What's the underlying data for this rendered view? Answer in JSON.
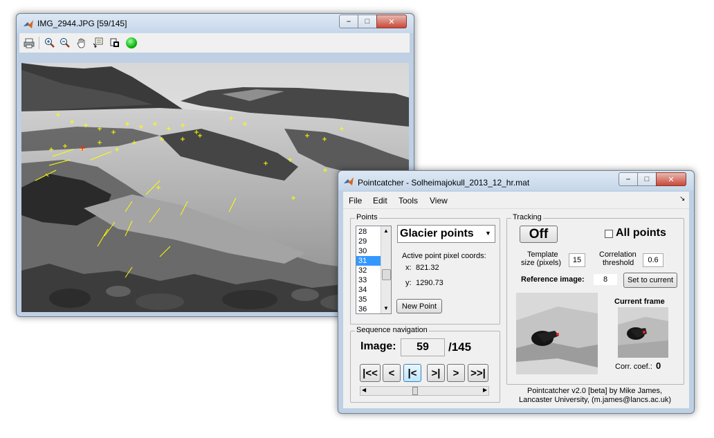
{
  "image_window": {
    "title": "IMG_2944.JPG  [59/145]",
    "toolbar": [
      {
        "name": "print-icon"
      },
      {
        "name": "zoom-in-icon"
      },
      {
        "name": "zoom-out-icon"
      },
      {
        "name": "pan-hand-icon"
      },
      {
        "name": "data-cursor-icon"
      },
      {
        "name": "insert-colorbar-icon"
      },
      {
        "name": "green-status-icon"
      }
    ]
  },
  "pointcatcher": {
    "title": "Pointcatcher - Solheimajokull_2013_12_hr.mat",
    "menu": [
      "File",
      "Edit",
      "Tools",
      "View"
    ],
    "points": {
      "label": "Points",
      "items": [
        "28",
        "29",
        "30",
        "31",
        "32",
        "33",
        "34",
        "35",
        "36"
      ],
      "selected": "31",
      "dropdown_value": "Glacier points",
      "coords_label": "Active point pixel coords:",
      "x_label": "x:",
      "x_value": "821.32",
      "y_label": "y:",
      "y_value": "1290.73",
      "new_point": "New Point"
    },
    "sequence": {
      "label": "Sequence navigation",
      "image_label": "Image:",
      "image_value": "59",
      "total": "/145",
      "buttons": [
        "|<<",
        "<",
        "|<",
        ">|",
        ">",
        ">>|"
      ]
    },
    "tracking": {
      "label": "Tracking",
      "toggle": "Off",
      "all_points": "All points",
      "template_label_1": "Template",
      "template_label_2": "size (pixels)",
      "template_value": "15",
      "corr_label_1": "Correlation",
      "corr_label_2": "threshold",
      "corr_value": "0.6",
      "ref_label": "Reference image:",
      "ref_value": "8",
      "set_current": "Set to current",
      "current_frame": "Current frame",
      "corr_coef_label": "Corr. coef.:",
      "corr_coef_value": "0"
    },
    "footer_1": "Pointcatcher v2.0 [beta] by Mike James,",
    "footer_2": "Lancaster University, (m.james@lancs.ac.uk)"
  }
}
